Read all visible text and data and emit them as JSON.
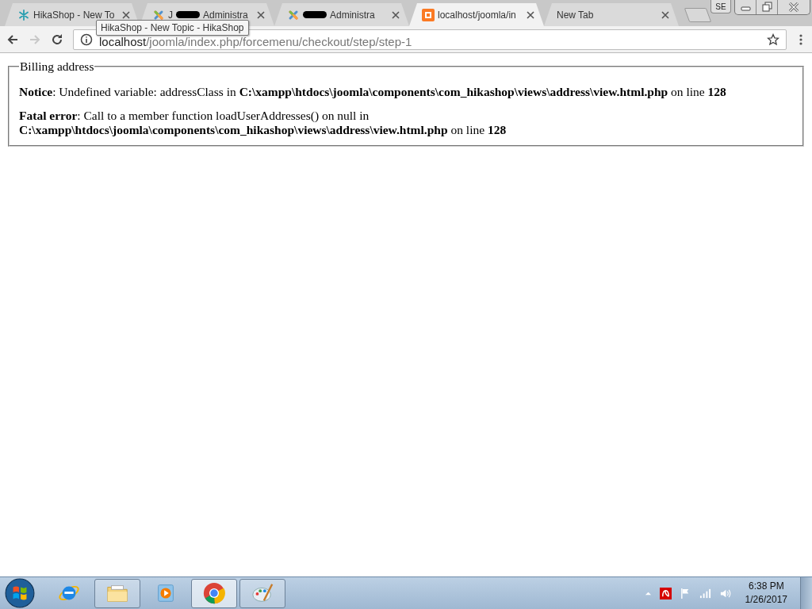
{
  "tabs": [
    {
      "kind": "forum",
      "title": "HikaShop - New To",
      "selected": false
    },
    {
      "kind": "cms",
      "title_start": "J",
      "redacted": true,
      "title": "Administra",
      "selected": false
    },
    {
      "kind": "cms",
      "redacted": true,
      "title": "Administra",
      "selected": false
    },
    {
      "kind": "server",
      "title": "localhost/joomla/in",
      "selected": true
    },
    {
      "kind": "blank",
      "title": "New Tab",
      "selected": false
    }
  ],
  "profile_button": "SE",
  "tooltip": "HikaShop - New Topic - HikaShop",
  "address": {
    "host": "localhost",
    "path": "/joomla/index.php/forcemenu/checkout/step/step-1"
  },
  "page": {
    "legend": "Billing address",
    "messages": [
      "**Notice**: Undefined variable: addressClass in **C:\\xampp\\htdocs\\joomla\\components\\com_hikashop\\views\\address\\view.html.php** on line **128**",
      "**Fatal error**: Call to a member function loadUserAddresses() on null in **C:\\xampp\\htdocs\\joomla\\components\\com_hikashop\\views\\address\\view.html.php** on line **128**"
    ]
  },
  "taskbar": {
    "apps": [
      {
        "kind": "browser",
        "running": false,
        "selected": false
      },
      {
        "kind": "folder",
        "running": true,
        "selected": false
      },
      {
        "kind": "player",
        "running": false,
        "selected": false
      },
      {
        "kind": "chrome",
        "running": true,
        "selected": true
      },
      {
        "kind": "paint",
        "running": true,
        "selected": false
      }
    ],
    "time": "6:38 PM",
    "date": "1/26/2017"
  }
}
